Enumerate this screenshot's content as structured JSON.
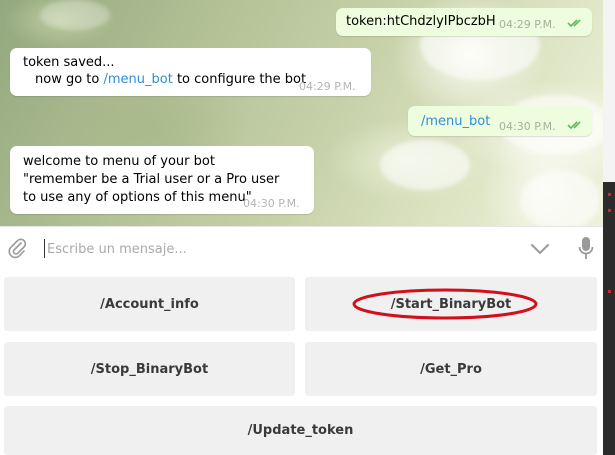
{
  "messages": [
    {
      "direction": "outgoing",
      "text": "token:htChdzlyIPbczbH",
      "time": "04:29 P.M.",
      "read": true
    },
    {
      "direction": "incoming",
      "line1": "token saved...",
      "line2_prefix": "now go to ",
      "line2_link": "/menu_bot",
      "line2_suffix": " to configure the bot",
      "time": "04:29 P.M."
    },
    {
      "direction": "outgoing",
      "text": "/menu_bot",
      "time": "04:30 P.M.",
      "read": true
    },
    {
      "direction": "incoming",
      "line1": "welcome to menu of your bot",
      "line2": "\"remember be a Trial user or a Pro user",
      "line3": "to use any of options of this menu\"",
      "time": "04:30 P.M."
    }
  ],
  "composer": {
    "placeholder": "Escribe un mensaje...",
    "value": "",
    "attach_icon": "paperclip-icon",
    "keyboard_toggle_icon": "chevron-down-icon",
    "mic_icon": "microphone-icon"
  },
  "keyboard": {
    "buttons": [
      {
        "label": "/Account_info"
      },
      {
        "label": "/Start_BinaryBot",
        "highlighted": true
      },
      {
        "label": "/Stop_BinaryBot"
      },
      {
        "label": "/Get_Pro"
      },
      {
        "label": "/Update_token"
      }
    ]
  },
  "colors": {
    "outgoing_bubble": "#eefdde",
    "incoming_bubble": "#ffffff",
    "link": "#2f8fd6",
    "read_ticks": "#5dbb5b",
    "highlight_annotation": "#d0101b",
    "keyboard_button": "#f0f0f0"
  }
}
